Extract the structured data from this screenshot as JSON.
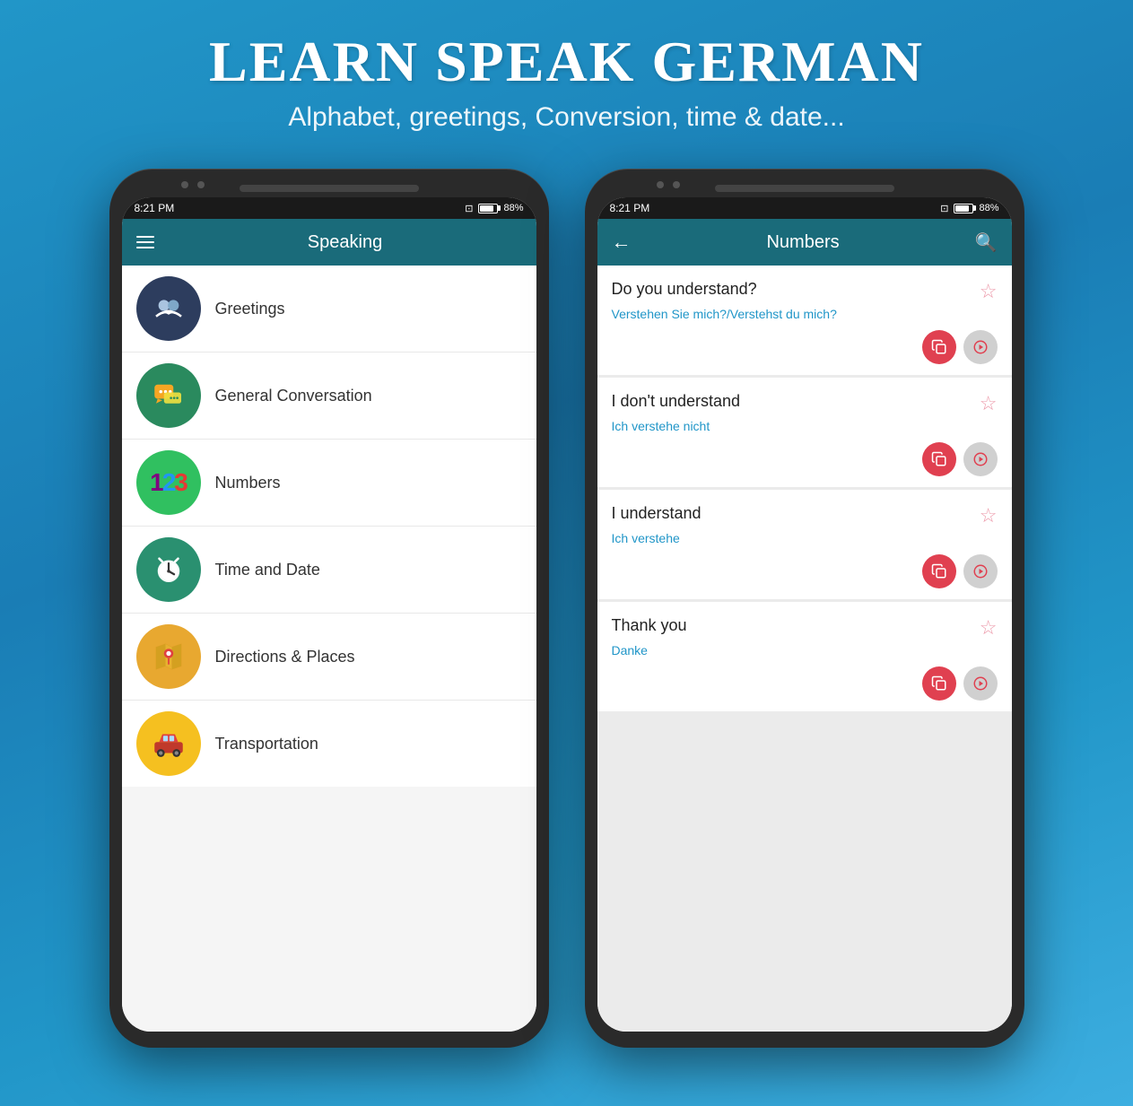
{
  "app": {
    "main_title": "LEARN SPEAK GERMAN",
    "subtitle": "Alphabet, greetings, Conversion, time & date..."
  },
  "phone_left": {
    "status": {
      "time": "8:21 PM",
      "battery_pct": "88%"
    },
    "app_bar": {
      "title": "Speaking"
    },
    "menu_items": [
      {
        "label": "Greetings",
        "icon_class": "icon-greetings",
        "icon_type": "handshake"
      },
      {
        "label": "General Conversation",
        "icon_class": "icon-conversation",
        "icon_type": "chat"
      },
      {
        "label": "Numbers",
        "icon_class": "icon-numbers",
        "icon_type": "numbers"
      },
      {
        "label": "Time and Date",
        "icon_class": "icon-timedate",
        "icon_type": "clock"
      },
      {
        "label": "Directions & Places",
        "icon_class": "icon-directions",
        "icon_type": "map"
      },
      {
        "label": "Transportation",
        "icon_class": "icon-transportation",
        "icon_type": "car"
      }
    ]
  },
  "phone_right": {
    "status": {
      "time": "8:21 PM",
      "battery_pct": "88%"
    },
    "app_bar": {
      "title": "Numbers"
    },
    "phrases": [
      {
        "english": "Do you understand?",
        "german": "Verstehen Sie mich?/Verstehst du mich?"
      },
      {
        "english": "I don't understand",
        "german": "Ich verstehe nicht"
      },
      {
        "english": "I understand",
        "german": "Ich verstehe"
      },
      {
        "english": "Thank you",
        "german": "Danke"
      }
    ],
    "buttons": {
      "copy_label": "📋",
      "speak_label": "🔊"
    }
  }
}
